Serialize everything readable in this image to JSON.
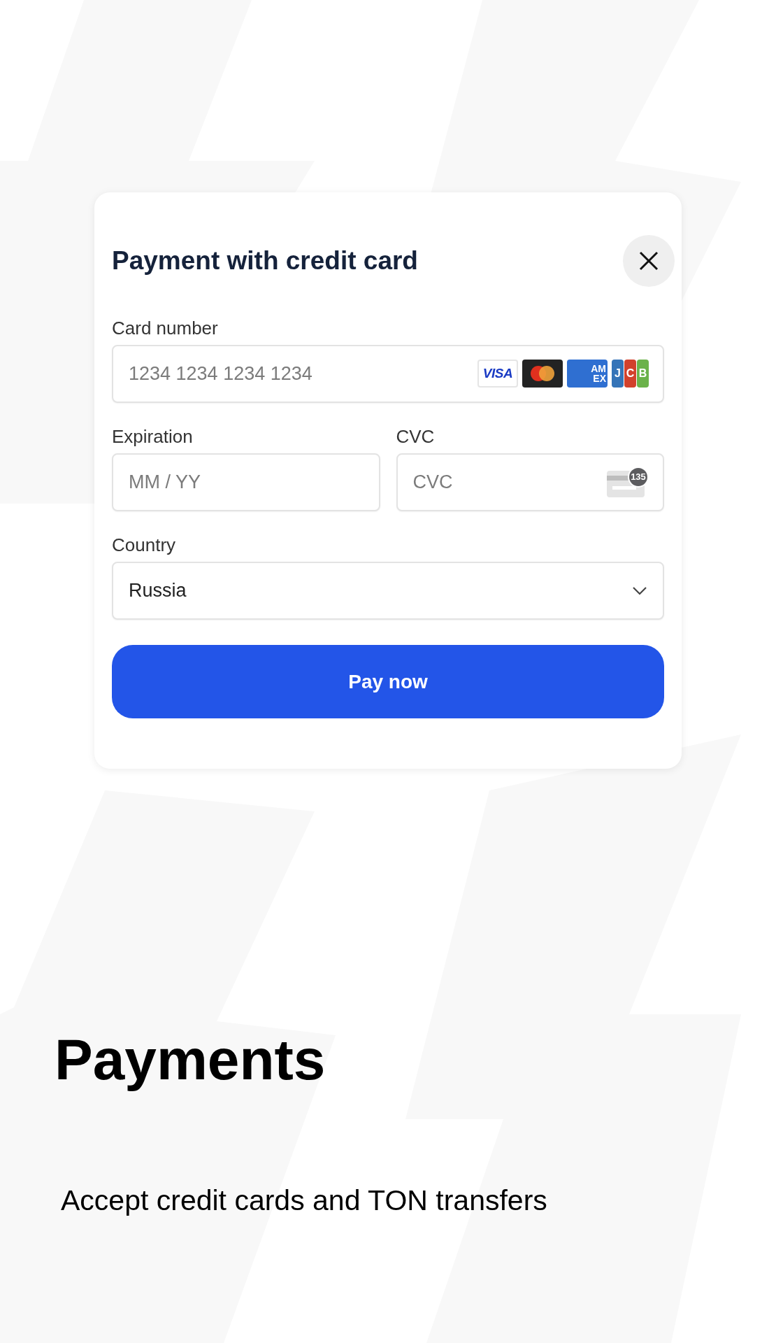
{
  "dialog": {
    "title": "Payment with credit card",
    "fields": [
      {
        "kind": "card",
        "label": "Card number",
        "placeholder": "1234 1234 1234 1234"
      },
      {
        "kind": "text",
        "label": "Expiration",
        "placeholder": "MM / YY"
      },
      {
        "kind": "cvc",
        "label": "CVC",
        "placeholder": "CVC",
        "badge": "135"
      },
      {
        "kind": "select",
        "label": "Country",
        "value": "Russia"
      }
    ],
    "card_brands": [
      {
        "kind": "visa",
        "text": [
          "VISA"
        ]
      },
      {
        "kind": "mastercard"
      },
      {
        "kind": "amex",
        "text": [
          "AM",
          "EX"
        ]
      },
      {
        "kind": "jcb",
        "text": [
          "J",
          "C",
          "B"
        ]
      }
    ],
    "submit": "Pay now"
  },
  "heading": "Payments",
  "subtitle": "Accept credit cards and TON transfers"
}
